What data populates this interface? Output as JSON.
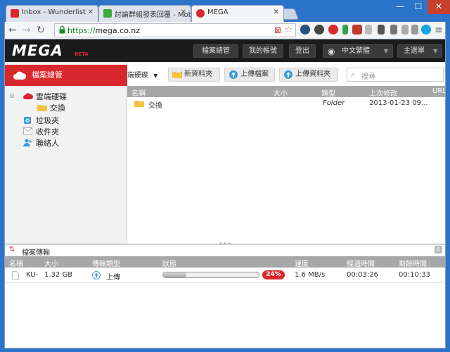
{
  "browser": {
    "tabs": [
      {
        "title": "Inbox - Wunderlist",
        "favicon_color": "#d9272e"
      },
      {
        "title": "討論群組發表回覆 - Mob",
        "favicon_color": "#3bab3b"
      },
      {
        "title": "MEGA",
        "favicon_color": "#d9272e"
      }
    ],
    "url_protocol": "https://",
    "url_host": "mega.co.nz"
  },
  "header": {
    "logo": "MEGA",
    "beta": "BETA",
    "buttons": {
      "file_manager": "檔案總管",
      "my_account": "我的帳號",
      "logout": "登出",
      "language": "中文繁體",
      "main_menu": "主選單"
    }
  },
  "sidebar": {
    "title": "檔案總管",
    "tree": {
      "cloud_drive": "雲端硬碟",
      "folder": "交換",
      "trash": "垃圾夾",
      "inbox": "收件夾",
      "contacts": "聯絡人"
    }
  },
  "actions": {
    "breadcrumb": "端硬碟",
    "new_folder": "新資料夾",
    "upload_file": "上傳檔案",
    "upload_folder": "上傳資料夾",
    "search_placeholder": "搜尋"
  },
  "files": {
    "columns": {
      "name": "名稱",
      "size": "大小",
      "type": "類型",
      "modified": "上次修改",
      "url": "URL"
    },
    "rows": [
      {
        "name": "交換",
        "size": "",
        "type": "Folder",
        "modified": "2013-01-23 09..."
      }
    ]
  },
  "transfers": {
    "title": "檔案傳輸",
    "columns": {
      "name": "名稱",
      "size": "大小",
      "transfer_type": "傳輸類型",
      "status": "狀態",
      "speed": "速度",
      "elapsed": "經過時間",
      "remaining": "剩餘時間"
    },
    "rows": [
      {
        "name": "KU-",
        "size": "1.32 GB",
        "transfer_type": "上傳",
        "progress_percent": 24,
        "progress_label": "24%",
        "speed": "1.6 MB/s",
        "elapsed": "00:03:26",
        "remaining": "00:10:33"
      }
    ]
  },
  "colors": {
    "brand_red": "#d9272e",
    "header_dark": "#1b1b1b",
    "window_blue": "#2b74c9"
  }
}
